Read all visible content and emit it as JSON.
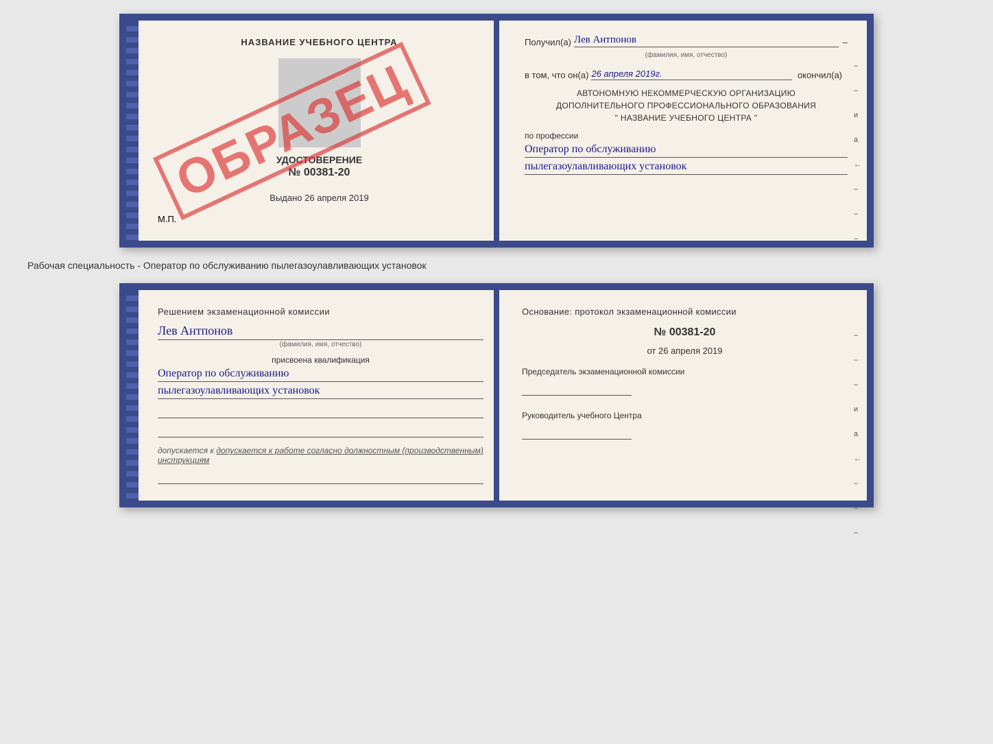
{
  "page": {
    "background": "#e8e8e8"
  },
  "certificate": {
    "left": {
      "title": "НАЗВАНИЕ УЧЕБНОГО ЦЕНТРА",
      "doc_label": "УДОСТОВЕРЕНИЕ",
      "doc_number": "№ 00381-20",
      "issued_label": "Выдано",
      "issued_date": "26 апреля 2019",
      "mp_label": "М.П.",
      "stamp_text": "ОБРАЗЕЦ"
    },
    "right": {
      "received_label": "Получил(а)",
      "received_name": "Лев Антпонов",
      "name_sub": "(фамилия, имя, отчество)",
      "date_prefix": "в том, что он(а)",
      "date_value": "26 апреля 2019г.",
      "date_suffix": "окончил(а)",
      "org_line1": "АВТОНОМНУЮ НЕКОММЕРЧЕСКУЮ ОРГАНИЗАЦИЮ",
      "org_line2": "ДОПОЛНИТЕЛЬНОГО ПРОФЕССИОНАЛЬНОГО ОБРАЗОВАНИЯ",
      "org_line3": "\" НАЗВАНИЕ УЧЕБНОГО ЦЕНТРА \"",
      "profession_label": "по профессии",
      "profession_line1": "Оператор по обслуживанию",
      "profession_line2": "пылегазоулавливающих установок",
      "side_marks": [
        "–",
        "–",
        "и",
        "а",
        "←",
        "–",
        "–",
        "–"
      ]
    }
  },
  "middle_text": "Рабочая специальность - Оператор по обслуживанию пылегазоулавливающих установок",
  "qualification": {
    "left": {
      "section_title": "Решением экзаменационной комиссии",
      "name_value": "Лев Антпонов",
      "name_sub": "(фамилия, имя, отчество)",
      "assigned_label": "присвоена квалификация",
      "profession_line1": "Оператор по обслуживанию",
      "profession_line2": "пылегазоулавливающих установок",
      "admission_text": "допускается к работе согласно должностным (производственным) инструкциям"
    },
    "right": {
      "title": "Основание: протокол экзаменационной комиссии",
      "protocol_number": "№ 00381-20",
      "date_prefix": "от",
      "date_value": "26 апреля 2019",
      "chairman_label": "Председатель экзаменационной комиссии",
      "director_label": "Руководитель учебного Центра",
      "side_marks": [
        "–",
        "–",
        "–",
        "и",
        "а",
        "←",
        "–",
        "–",
        "–"
      ]
    }
  }
}
